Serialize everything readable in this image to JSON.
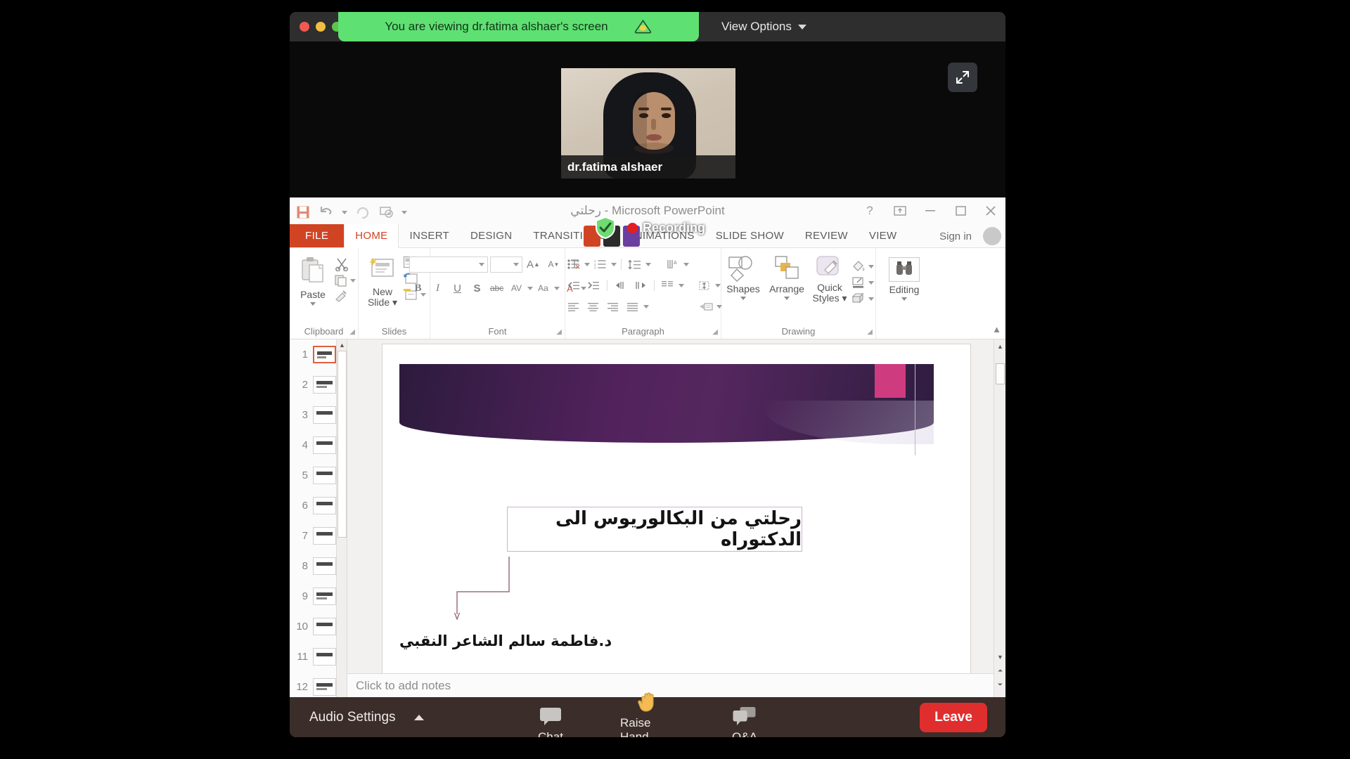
{
  "zoom": {
    "sharing_banner": "You are viewing dr.fatima alshaer's screen",
    "cloud_icon": "cloud-icon",
    "view_options": "View Options",
    "expand_icon": "expand-icon",
    "recording_label": "Recording",
    "video": {
      "participant_name": "dr.fatima alshaer"
    },
    "bottombar": {
      "audio_settings": "Audio Settings",
      "buttons": [
        {
          "name": "chat",
          "label": "Chat",
          "icon": "speech-bubble-icon"
        },
        {
          "name": "raise-hand",
          "label": "Raise Hand",
          "icon": "raised-hand-icon"
        },
        {
          "name": "qa",
          "label": "Q&A",
          "icon": "double-speech-bubble-icon"
        }
      ],
      "leave_label": "Leave",
      "leave_color": "#e02d2d"
    }
  },
  "powerpoint": {
    "title": "رحلتي - Microsoft PowerPoint",
    "window_controls": [
      "?",
      "ribbon-display-options",
      "minimize",
      "maximize",
      "close"
    ],
    "quick_access": [
      "save-icon",
      "undo-icon",
      "redo-icon",
      "start-slideshow-icon",
      "customize-qat-icon"
    ],
    "tabs": [
      {
        "label": "FILE",
        "active": false,
        "file": true
      },
      {
        "label": "HOME",
        "active": true
      },
      {
        "label": "INSERT",
        "active": false
      },
      {
        "label": "DESIGN",
        "active": false
      },
      {
        "label": "TRANSITIONS",
        "active": false
      },
      {
        "label": "ANIMATIONS",
        "active": false
      },
      {
        "label": "SLIDE SHOW",
        "active": false
      },
      {
        "label": "REVIEW",
        "active": false
      },
      {
        "label": "VIEW",
        "active": false
      }
    ],
    "sign_in": "Sign in",
    "ribbon": {
      "groups": [
        {
          "name": "Clipboard",
          "label": "Clipboard"
        },
        {
          "name": "Slides",
          "label": "Slides"
        },
        {
          "name": "Font",
          "label": "Font"
        },
        {
          "name": "Paragraph",
          "label": "Paragraph"
        },
        {
          "name": "Drawing",
          "label": "Drawing"
        },
        {
          "name": "Editing",
          "label": "Editing"
        }
      ],
      "paste_label": "Paste",
      "new_slide_label_1": "New",
      "new_slide_label_2": "Slide",
      "shapes_label": "Shapes",
      "arrange_label": "Arrange",
      "quick_styles_1": "Quick",
      "quick_styles_2": "Styles",
      "editing_label": "Editing",
      "font_name": "",
      "font_size": "",
      "bold": "B",
      "italic": "I",
      "underline": "U",
      "shadow": "S",
      "strikethrough": "abc",
      "char_spacing": "AV",
      "change_case": "Aa"
    },
    "thumbnails": [
      {
        "number": "1",
        "selected": true
      },
      {
        "number": "2",
        "selected": false
      },
      {
        "number": "3",
        "selected": false
      },
      {
        "number": "4",
        "selected": false
      },
      {
        "number": "5",
        "selected": false
      },
      {
        "number": "6",
        "selected": false
      },
      {
        "number": "7",
        "selected": false
      },
      {
        "number": "8",
        "selected": false
      },
      {
        "number": "9",
        "selected": false
      },
      {
        "number": "10",
        "selected": false
      },
      {
        "number": "11",
        "selected": false
      },
      {
        "number": "12",
        "selected": false
      }
    ],
    "slide": {
      "title": "رحلتي من البكالوريوس الى الدكتوراه",
      "author": "د.فاطمة سالم الشاعر النقبي",
      "banner_color": "#51225c",
      "accent_color": "#c72a72"
    },
    "notes_placeholder": "Click to add notes"
  }
}
